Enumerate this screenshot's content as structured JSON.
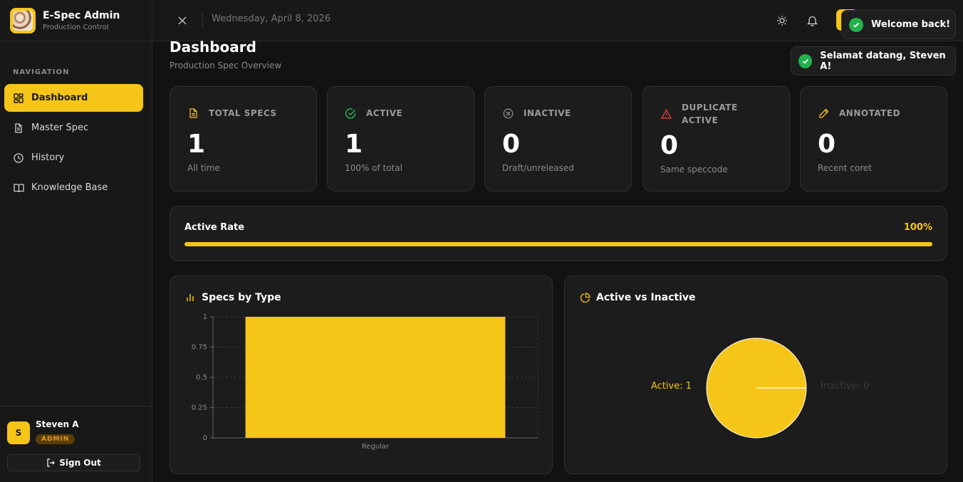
{
  "brand": {
    "title": "E-Spec Admin",
    "subtitle": "Production Control"
  },
  "sidebar": {
    "nav_label": "NAVIGATION",
    "items": [
      {
        "label": "Dashboard",
        "icon": "grid-icon",
        "active": true
      },
      {
        "label": "Master Spec",
        "icon": "document-icon",
        "active": false
      },
      {
        "label": "History",
        "icon": "clock-icon",
        "active": false
      },
      {
        "label": "Knowledge Base",
        "icon": "book-icon",
        "active": false
      }
    ]
  },
  "user": {
    "initial": "S",
    "name": "Steven A",
    "role": "ADMIN",
    "signout_label": "Sign Out"
  },
  "topbar": {
    "date": "Wednesday, April 8, 2026"
  },
  "toasts": [
    {
      "message": "Welcome back!"
    },
    {
      "message": "Selamat datang, Steven A!"
    }
  ],
  "page": {
    "title": "Dashboard",
    "subtitle": "Production Spec Overview"
  },
  "stats": [
    {
      "label": "TOTAL SPECS",
      "value": "1",
      "note": "All time",
      "icon": "document-icon",
      "color": "#f5c518"
    },
    {
      "label": "ACTIVE",
      "value": "1",
      "note": "100% of total",
      "icon": "check-circle-icon",
      "color": "#22c55e"
    },
    {
      "label": "INACTIVE",
      "value": "0",
      "note": "Draft/unreleased",
      "icon": "x-circle-icon",
      "color": "#8a8a8a"
    },
    {
      "label_line1": "DUPLICATE",
      "label_line2": "ACTIVE",
      "value": "0",
      "note": "Same speccode",
      "icon": "warning-icon",
      "color": "#ef4444"
    },
    {
      "label": "ANNOTATED",
      "value": "0",
      "note": "Recent coret",
      "icon": "pencil-icon",
      "color": "#f5c518"
    }
  ],
  "active_rate": {
    "label": "Active Rate",
    "value_text": "100%",
    "fraction": 1.0
  },
  "charts": {
    "by_type_title": "Specs by Type",
    "pie_title": "Active vs Inactive",
    "pie_active_label": "Active: 1",
    "pie_inactive_label": "Inactive: 0"
  },
  "chart_data": [
    {
      "type": "bar",
      "title": "Specs by Type",
      "categories": [
        "Regular"
      ],
      "values": [
        1
      ],
      "yticks": [
        "0",
        "0.25",
        "0.5",
        "0.75",
        "1"
      ],
      "ylim": [
        0,
        1
      ],
      "grid": true,
      "color": "#f5c518"
    },
    {
      "type": "pie",
      "title": "Active vs Inactive",
      "categories": [
        "Active",
        "Inactive"
      ],
      "values": [
        1,
        0
      ],
      "colors": [
        "#f5c518",
        "#3a3a3a"
      ]
    }
  ],
  "colors": {
    "accent": "#f5c518",
    "background": "#121212",
    "card": "#1c1c1c",
    "success": "#22b24c"
  }
}
